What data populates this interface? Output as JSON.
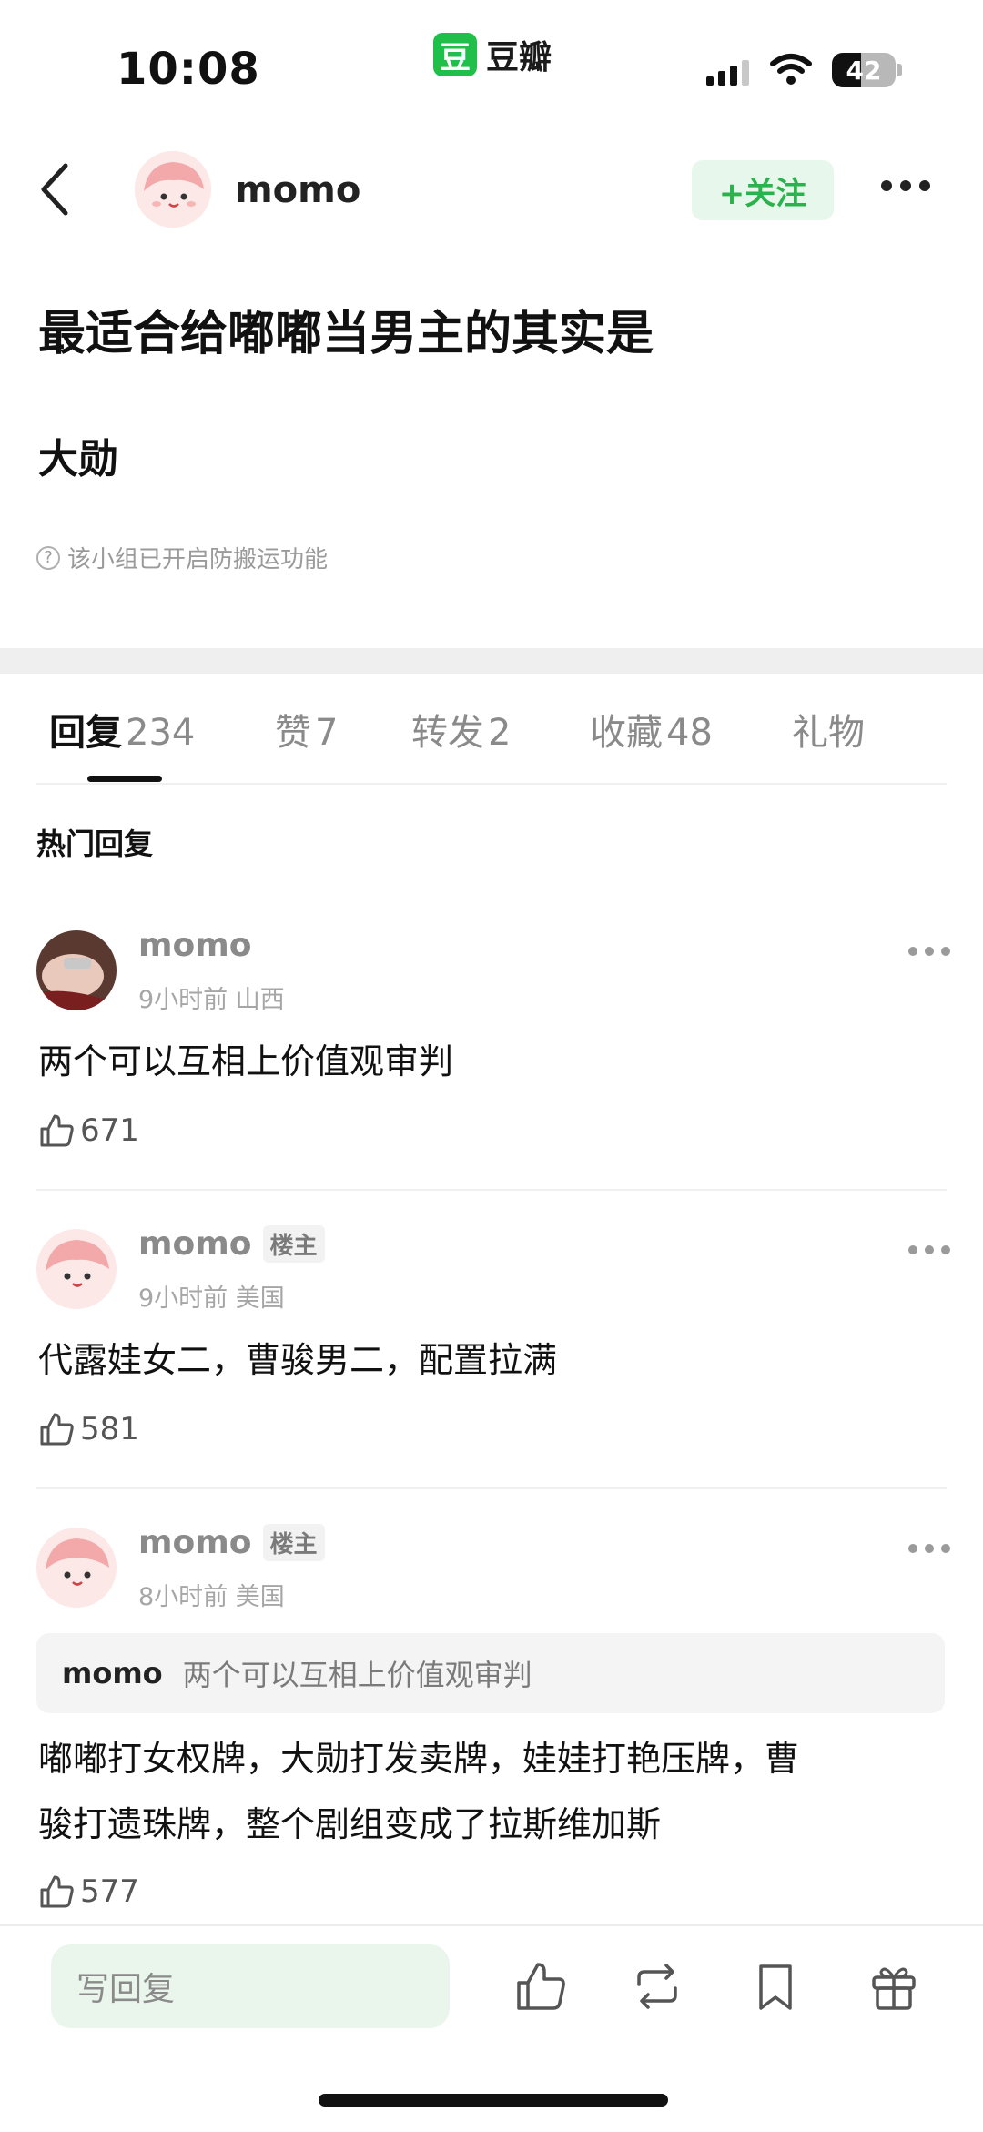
{
  "status": {
    "time": "10:08",
    "app_logo": "豆",
    "app_name": "豆瓣",
    "battery": "42"
  },
  "header": {
    "author": "momo",
    "follow_label": "+关注"
  },
  "post": {
    "title": "最适合给嘟嘟当男主的其实是",
    "body": "大勋",
    "notice": "该小组已开启防搬运功能"
  },
  "tabs": [
    {
      "label": "回复",
      "count": "234"
    },
    {
      "label": "赞",
      "count": "7"
    },
    {
      "label": "转发",
      "count": "2"
    },
    {
      "label": "收藏",
      "count": "48"
    },
    {
      "label": "礼物",
      "count": ""
    }
  ],
  "section_title": "热门回复",
  "comments": [
    {
      "user": "momo",
      "badge": "",
      "time": "9小时前",
      "location": "山西",
      "text": "两个可以互相上价值观审判",
      "likes": "671"
    },
    {
      "user": "momo",
      "badge": "楼主",
      "time": "9小时前",
      "location": "美国",
      "text": "代露娃女二，曹骏男二，配置拉满",
      "likes": "581"
    },
    {
      "user": "momo",
      "badge": "楼主",
      "time": "8小时前",
      "location": "美国",
      "quote_user": "momo",
      "quote_text": "两个可以互相上价值观审判",
      "text_line1": "嘟嘟打女权牌，大勋打发卖牌，娃娃打艳压牌，曹",
      "text_line2": "骏打遗珠牌，整个剧组变成了拉斯维加斯",
      "likes": "577"
    }
  ],
  "bottom": {
    "reply_placeholder": "写回复"
  },
  "colors": {
    "accent_green": "#2bb24c",
    "follow_bg": "#e8f7ec"
  },
  "icons": [
    "back-icon",
    "more-icon",
    "thumb-up-icon",
    "repost-icon",
    "bookmark-icon",
    "gift-icon",
    "question-icon",
    "wifi-icon",
    "signal-icon",
    "battery-icon"
  ]
}
